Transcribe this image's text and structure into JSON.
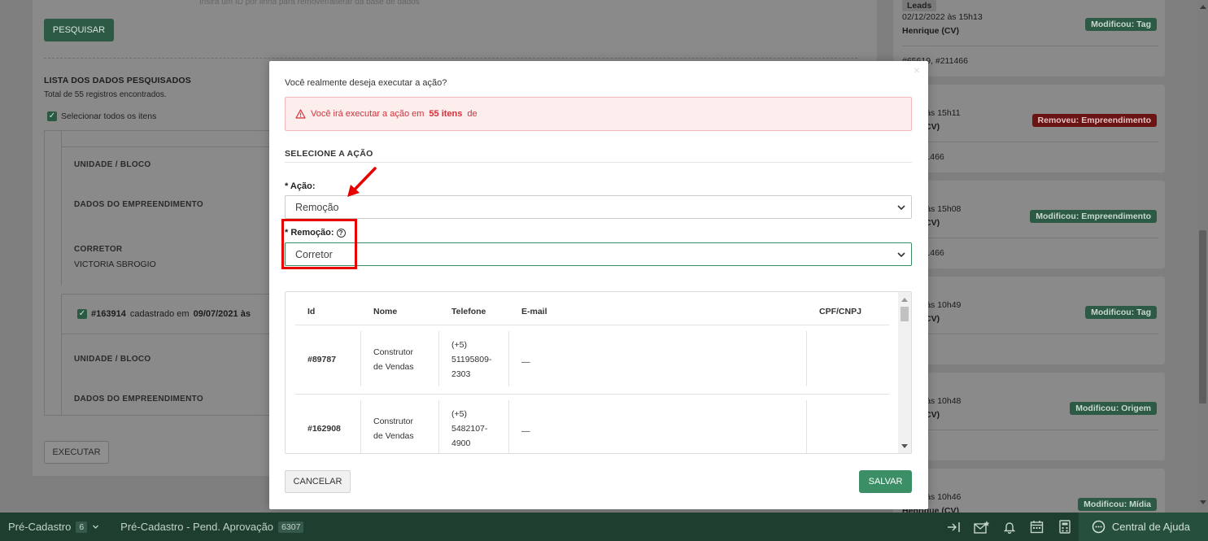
{
  "background": {
    "hint": "Insira um ID por linha para remover/alterar da base de dados",
    "search_button": "PESQUISAR",
    "list_title": "LISTA DOS DADOS PESQUISADOS",
    "total": "Total de 55 registros encontrados.",
    "select_all": "Selecionar todos os itens",
    "card1": {
      "unit_label": "UNIDADE / BLOCO",
      "project_label": "DADOS DO EMPREENDIMENTO",
      "broker_label": "CORRETOR",
      "broker_value": "VICTORIA SBROGIO"
    },
    "card2": {
      "id": "#163914",
      "registered_text": "cadastrado em",
      "date": "09/07/2021 às",
      "unit_label": "UNIDADE / BLOCO",
      "project_label": "DADOS DO EMPREENDIMENTO"
    },
    "execute_button": "EXECUTAR"
  },
  "activity": [
    {
      "title": "Leads",
      "date": "02/12/2022 às 15h13",
      "user": "Henrique (CV)",
      "ids": "#65619, #211466",
      "badge": "Modificou: Tag",
      "badge_color": "green"
    },
    {
      "title": "ls",
      "date": "/2022 às 15h11",
      "user": "ique (CV)",
      "ids": "9, #211466",
      "badge": "Removeu: Empreendimento",
      "badge_color": "red"
    },
    {
      "title": "ls",
      "date": "/2022 às 15h08",
      "user": "ique (CV)",
      "ids": "9, #211466",
      "badge": "Modificou: Empreendimento",
      "badge_color": "green"
    },
    {
      "title": "ls",
      "date": "/2022 às 10h49",
      "user": "ique (CV)",
      "ids": "99",
      "badge": "Modificou: Tag",
      "badge_color": "green"
    },
    {
      "title": "ls",
      "date": "/2022 às 10h48",
      "user": "ique (CV)",
      "ids": "00",
      "badge": "Modificou: Origem",
      "badge_color": "green"
    },
    {
      "title": "ls",
      "date": "/2022 às 10h46",
      "user": "Henrique (CV)",
      "ids": "",
      "badge": "Modificou: Mídia",
      "badge_color": "green"
    }
  ],
  "modal": {
    "question": "Você realmente deseja executar a ação?",
    "alert_prefix": "Você irá executar a ação em",
    "alert_count": "55 itens",
    "alert_suffix": "de",
    "section_title": "SELECIONE A AÇÃO",
    "action_label": "* Ação:",
    "action_value": "Remoção",
    "removal_label": "* Remoção:",
    "removal_value": "Corretor",
    "table": {
      "columns": [
        "Id",
        "Nome",
        "Telefone",
        "E-mail",
        "CPF/CNPJ"
      ],
      "rows": [
        {
          "id": "#89787",
          "name_1": "Construtor",
          "name_2": "de Vendas",
          "phone_1": "(+5)",
          "phone_2": "51195809-",
          "phone_3": "2303",
          "email": "—",
          "doc": ""
        },
        {
          "id": "#162908",
          "name_1": "Construtor",
          "name_2": "de Vendas",
          "phone_1": "(+5)",
          "phone_2": "5482107-",
          "phone_3": "4900",
          "email": "—",
          "doc": ""
        }
      ]
    },
    "cancel": "CANCELAR",
    "save": "SALVAR",
    "close": "×"
  },
  "bottom_bar": {
    "tab1_label": "Pré-Cadastro",
    "tab1_count": "6",
    "tab2_label": "Pré-Cadastro - Pend. Aprovação",
    "tab2_count": "6307",
    "help": "Central de Ajuda"
  },
  "colors": {
    "primary_green": "#3b8e66",
    "alert_red": "#d3313a",
    "highlight_red": "#e60000",
    "bar_green": "#1e3f2f"
  }
}
